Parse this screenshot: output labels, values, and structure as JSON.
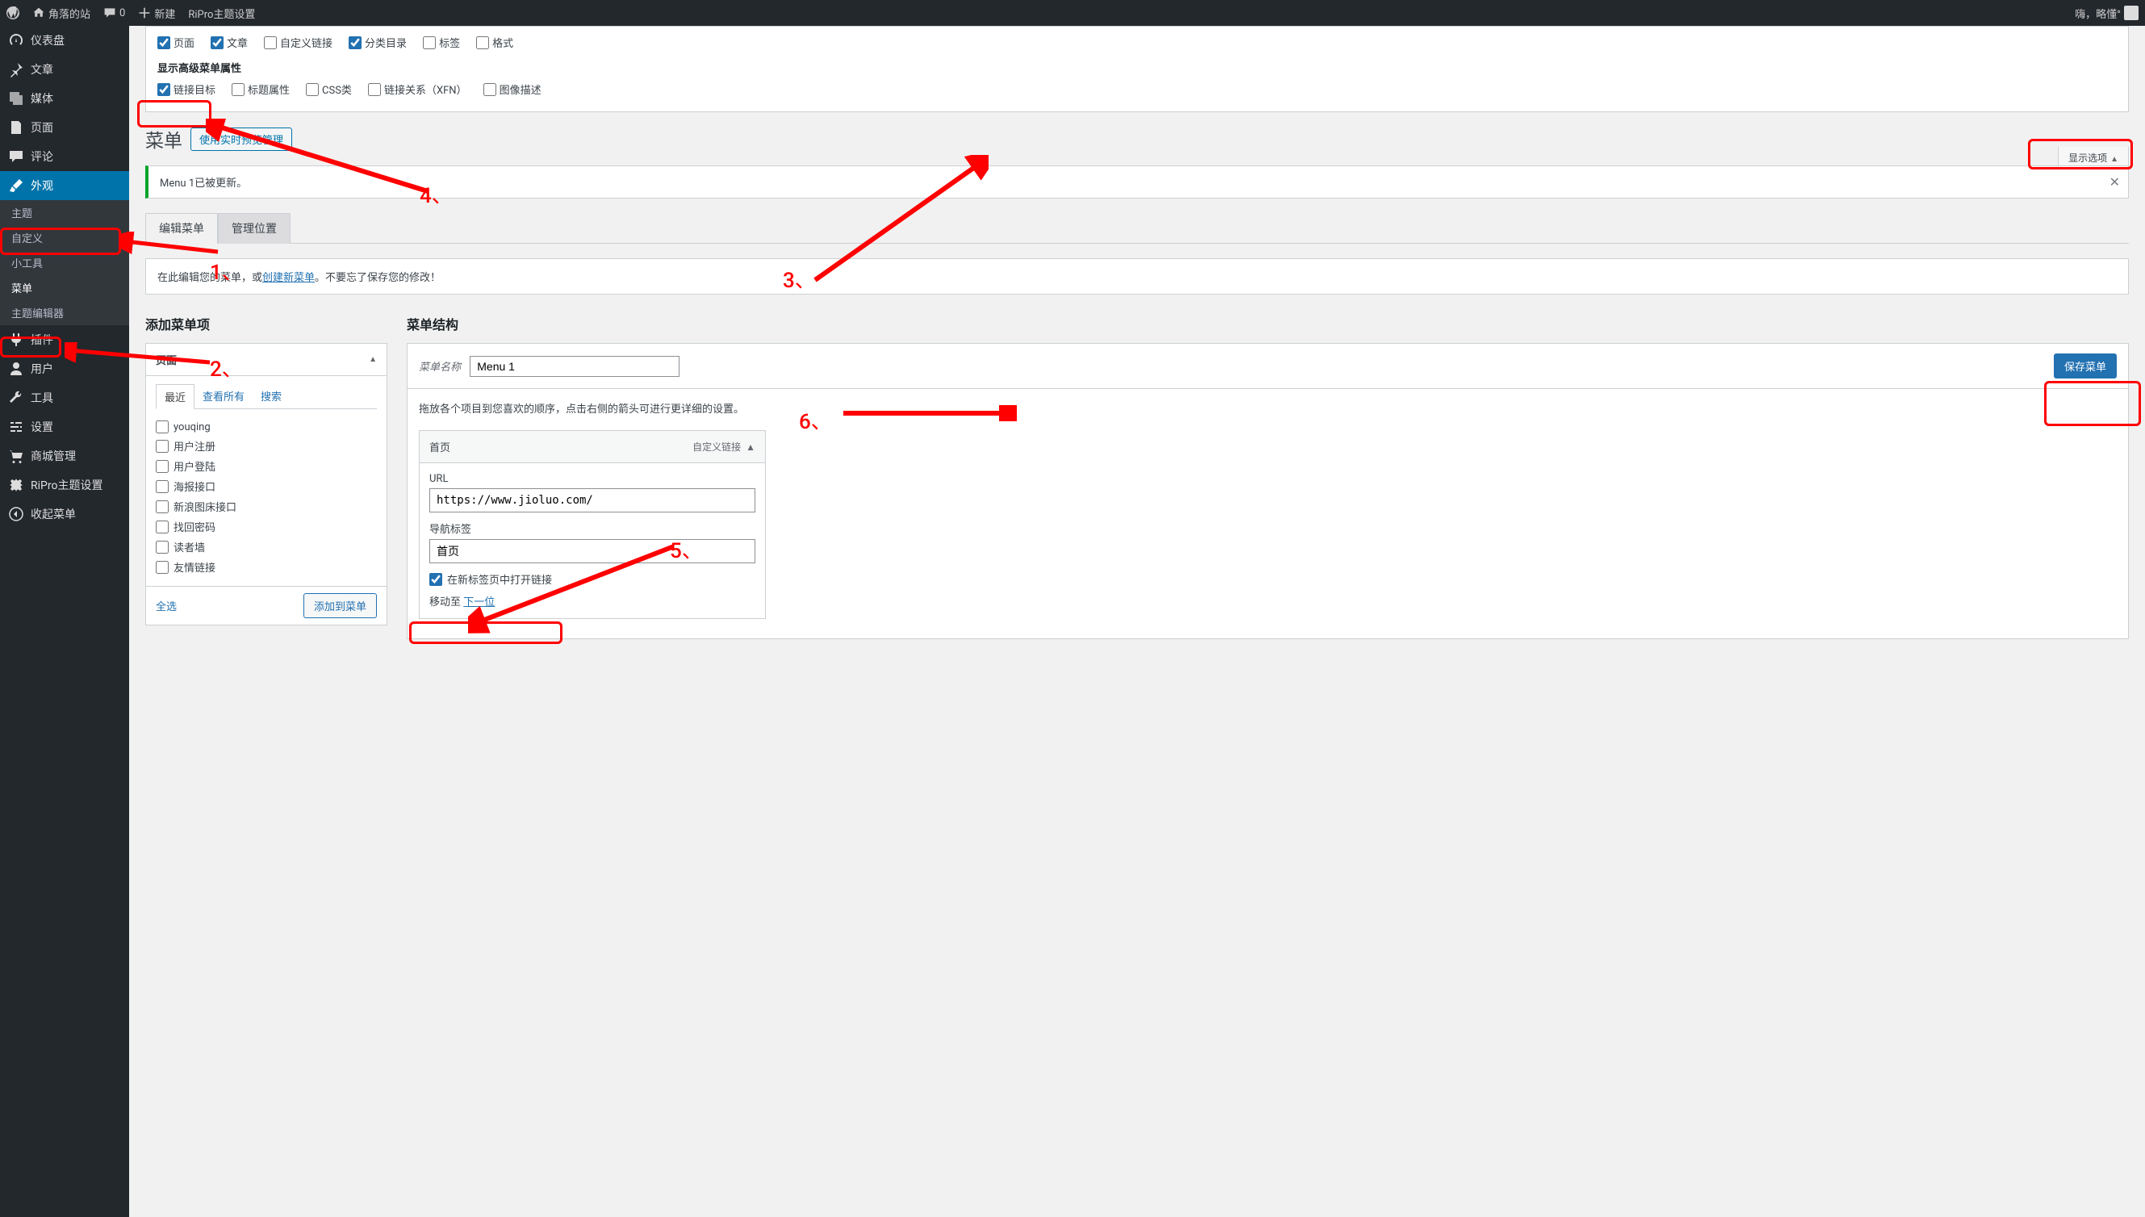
{
  "adminbar": {
    "site_name": "角落的站",
    "comments": "0",
    "new": "新建",
    "theme_settings": "RiPro主题设置",
    "greeting": "嗨，略懂°"
  },
  "sidebar": {
    "items": {
      "dashboard": "仪表盘",
      "posts": "文章",
      "media": "媒体",
      "pages": "页面",
      "comments": "评论",
      "appearance": "外观",
      "plugins": "插件",
      "users": "用户",
      "tools": "工具",
      "settings": "设置",
      "mall": "商城管理",
      "ripro": "RiPro主题设置",
      "collapse": "收起菜单"
    },
    "submenu": {
      "themes": "主题",
      "customize": "自定义",
      "widgets": "小工具",
      "menus": "菜单",
      "editor": "主题编辑器"
    }
  },
  "screen_options": {
    "row1": {
      "page": "页面",
      "post": "文章",
      "custom": "自定义链接",
      "cat": "分类目录",
      "tag": "标签",
      "format": "格式"
    },
    "row1_checked": {
      "page": true,
      "post": true,
      "custom": false,
      "cat": true,
      "tag": false,
      "format": false
    },
    "adv_heading": "显示高级菜单属性",
    "row2": {
      "target": "链接目标",
      "title": "标题属性",
      "css": "CSS类",
      "xfn": "链接关系（XFN）",
      "desc": "图像描述"
    },
    "row2_checked": {
      "target": true,
      "title": false,
      "css": false,
      "xfn": false,
      "desc": false
    },
    "tab_label": "显示选项"
  },
  "page": {
    "title": "菜单",
    "preview_btn": "使用实时预览管理",
    "notice": "Menu 1已被更新。"
  },
  "tabs": {
    "edit": "编辑菜单",
    "locations": "管理位置"
  },
  "help": {
    "pre": "在此编辑您的菜单，或",
    "link": "创建新菜单",
    "post": "。不要忘了保存您的修改！"
  },
  "left_col": {
    "title": "添加菜单项",
    "postbox_title": "页面",
    "inner_tabs": {
      "recent": "最近",
      "all": "查看所有",
      "search": "搜索"
    },
    "items": [
      "youqing",
      "用户注册",
      "用户登陆",
      "海报接口",
      "新浪图床接口",
      "找回密码",
      "读者墙",
      "友情链接"
    ],
    "select_all": "全选",
    "add_btn": "添加到菜单"
  },
  "right_col": {
    "title": "菜单结构",
    "name_label": "菜单名称",
    "name_value": "Menu 1",
    "save_btn": "保存菜单",
    "desc": "拖放各个项目到您喜欢的顺序，点击右侧的箭头可进行更详细的设置。",
    "item": {
      "title": "首页",
      "type": "自定义链接",
      "url_label": "URL",
      "url_value": "https://www.jioluo.com/",
      "nav_label": "导航标签",
      "nav_value": "首页",
      "newtab": "在新标签页中打开链接",
      "move_label": "移动至",
      "move_next": "下一位"
    }
  },
  "annotations": {
    "1": "1、",
    "2": "2、",
    "3": "3、",
    "4": "4、",
    "5": "5、",
    "6": "6、"
  }
}
